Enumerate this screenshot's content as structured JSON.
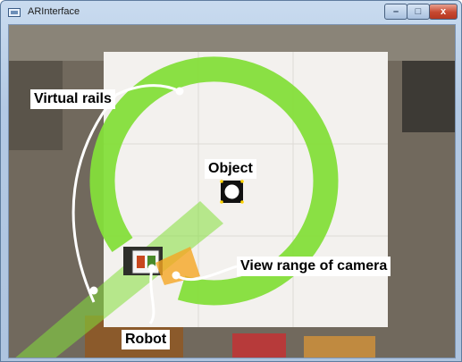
{
  "window": {
    "title": "ARInterface",
    "minimize_glyph": "–",
    "maximize_glyph": "□",
    "close_glyph": "x"
  },
  "annotations": {
    "virtual_rails": "Virtual rails",
    "object": "Object",
    "view_range": "View range of camera",
    "robot": "Robot"
  },
  "colors": {
    "rail": "#84de3a",
    "camera_range": "#f5a623",
    "floor_paper": "#f3f1ee",
    "titlebar": "#b7cbe4"
  },
  "icons": {
    "app": "window-app-icon",
    "minimize": "minimize-icon",
    "maximize": "maximize-icon",
    "close": "close-icon"
  }
}
